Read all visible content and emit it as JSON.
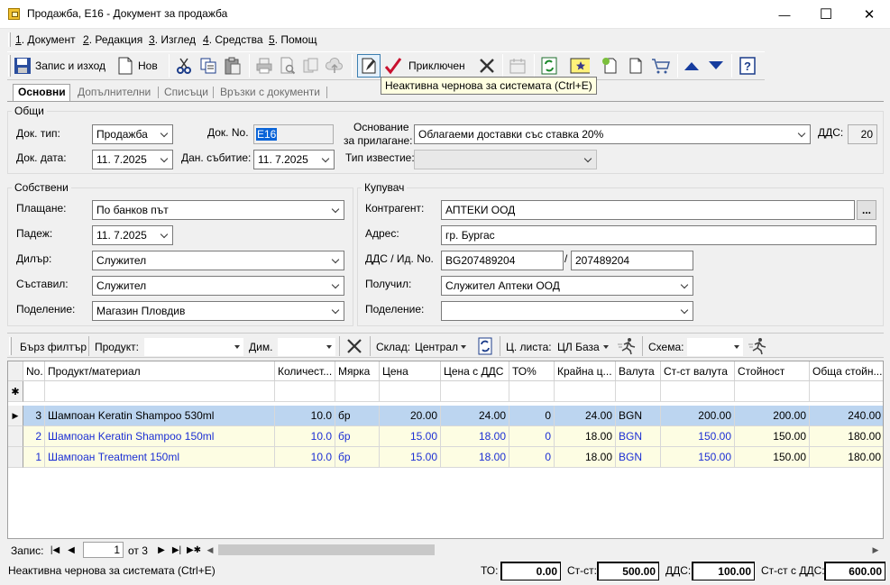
{
  "window": {
    "title": "Продажба, Е16 - Документ за продажба",
    "minimize": "—",
    "maximize": "☐",
    "close": "✕"
  },
  "menu": [
    {
      "key": "1",
      "rest": ". Документ"
    },
    {
      "key": "2",
      "rest": ". Редакция"
    },
    {
      "key": "3",
      "rest": ". Изглед"
    },
    {
      "key": "4",
      "rest": ". Средства"
    },
    {
      "key": "5",
      "rest": ". Помощ"
    }
  ],
  "toolbar": {
    "save_exit": "Запис и изход",
    "new": "Нов",
    "finish": "Приключен"
  },
  "tooltip": "Неактивна чернова за системата (Ctrl+E)",
  "tabs": [
    "Основни",
    "Допълнителни",
    "Списъци",
    "Връзки с документи"
  ],
  "general": {
    "title": "Общи",
    "doc_type_label": "Док. тип:",
    "doc_type": "Продажба",
    "doc_no_label": "Док. No.",
    "doc_no": "Е16",
    "basis_label1": "Основание",
    "basis_label2": "за прилагане:",
    "basis": "Облагаеми доставки със ставка 20%",
    "vat_label": "ДДС:",
    "vat": "20",
    "doc_date_label": "Док. дата:",
    "doc_date": "11.  7.2025",
    "tax_event_label": "Дан. събитие:",
    "tax_event": "11.  7.2025",
    "notice_type_label": "Тип известие:",
    "notice_type": ""
  },
  "own": {
    "title": "Собствени",
    "payment_label": "Плащане:",
    "payment": "По банков път",
    "due_label": "Падеж:",
    "due": "11.  7.2025",
    "dealer_label": "Дилър:",
    "dealer": "Служител",
    "composer_label": "Съставил:",
    "composer": "Служител",
    "division_label": "Поделение:",
    "division": "Магазин Пловдив"
  },
  "buyer": {
    "title": "Купувач",
    "partner_label": "Контрагент:",
    "partner": "АПТЕКИ ООД",
    "browse": "...",
    "address_label": "Адрес:",
    "address": "гр. Бургас",
    "vat_id_label": "ДДС / Ид. No.",
    "vat_no": "BG207489204",
    "slash": "/",
    "id_no": "207489204",
    "receiver_label": "Получил:",
    "receiver": "Служител Аптеки ООД",
    "division_label": "Поделение:",
    "division": ""
  },
  "filter": {
    "quick_filter": "Бърз филтър",
    "product_label": "Продукт:",
    "product": "",
    "dim_label": "Дим.",
    "dim": "",
    "warehouse_label": "Склад:",
    "warehouse": "Централ",
    "pricelist_label": "Ц. листа:",
    "pricelist": "ЦЛ База",
    "scheme_label": "Схема:",
    "scheme": ""
  },
  "grid": {
    "columns": [
      "No.",
      "Продукт/материал",
      "Количест...",
      "Мярка",
      "Цена",
      "Цена с ДДС",
      "ТО%",
      "Крайна ц...",
      "Валута",
      "Ст-ст валута",
      "Стойност",
      "Обща стойн..."
    ],
    "new_row_marker": "✱",
    "current_row_marker": "▶",
    "rows": [
      [
        "3",
        "Шампоан Keratin Shampoo 530ml",
        "10.0",
        "бр",
        "20.00",
        "24.00",
        "0",
        "24.00",
        "BGN",
        "200.00",
        "200.00",
        "240.00"
      ],
      [
        "2",
        "Шампоан Keratin Shampoo 150ml",
        "10.0",
        "бр",
        "15.00",
        "18.00",
        "0",
        "18.00",
        "BGN",
        "150.00",
        "150.00",
        "180.00"
      ],
      [
        "1",
        "Шампоан Treatment 150ml",
        "10.0",
        "бр",
        "15.00",
        "18.00",
        "0",
        "18.00",
        "BGN",
        "150.00",
        "150.00",
        "180.00"
      ]
    ]
  },
  "nav": {
    "record_label": "Запис:",
    "current": "1",
    "of": "от 3"
  },
  "status": {
    "text": "Неактивна чернова за системата (Ctrl+E)",
    "discount_label": "ТО:",
    "discount": "0.00",
    "cost_label": "Ст-ст:",
    "cost": "500.00",
    "vat_label": "ДДС:",
    "vat": "100.00",
    "total_label": "Ст-ст с ДДС:",
    "total": "600.00"
  }
}
